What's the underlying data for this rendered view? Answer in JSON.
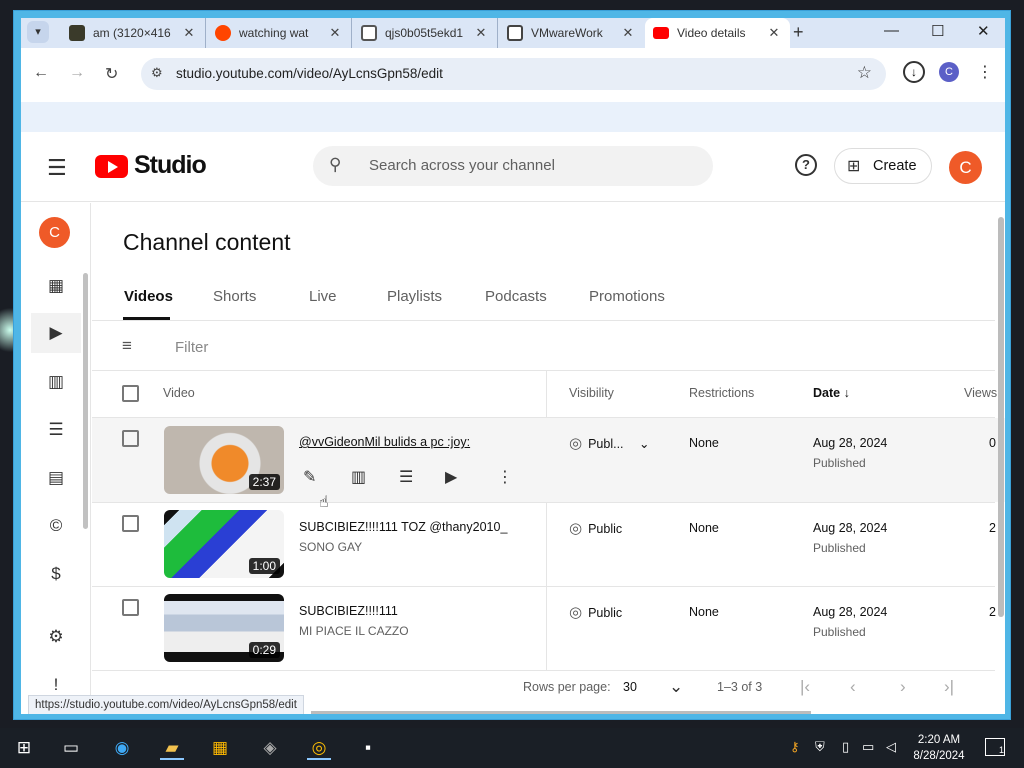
{
  "browser": {
    "tabs": [
      {
        "title": "am (3120×416",
        "favicon_color": "#3a3a2a"
      },
      {
        "title": "watching wat",
        "favicon_color": "#ff4500"
      },
      {
        "title": "qjs0b05t5ekd1",
        "favicon_color": "#555555"
      },
      {
        "title": "VMwareWork",
        "favicon_color": "#444444"
      },
      {
        "title": "Video details",
        "favicon_color": "#ff0000"
      }
    ],
    "new_tab": "+",
    "url": "studio.youtube.com/video/AyLcnsGpn58/edit",
    "profile_initial": "C",
    "status_url": "https://studio.youtube.com/video/AyLcnsGpn58/edit"
  },
  "header": {
    "logo_text": "Studio",
    "search_placeholder": "Search across your channel",
    "help": "?",
    "create_label": "Create",
    "avatar_initial": "C"
  },
  "sidebar": {
    "avatar_initial": "C",
    "items": [
      {
        "name": "dashboard-icon",
        "glyph": "▦"
      },
      {
        "name": "content-icon",
        "glyph": "▶"
      },
      {
        "name": "analytics-icon",
        "glyph": "📊"
      },
      {
        "name": "comments-icon",
        "glyph": "☰"
      },
      {
        "name": "subtitles-icon",
        "glyph": "▤"
      },
      {
        "name": "copyright-icon",
        "glyph": "©"
      },
      {
        "name": "earn-icon",
        "glyph": "$"
      },
      {
        "name": "settings-icon",
        "glyph": "⚙"
      },
      {
        "name": "feedback-icon",
        "glyph": "!"
      }
    ]
  },
  "content": {
    "title": "Channel content",
    "tabs": [
      "Videos",
      "Shorts",
      "Live",
      "Playlists",
      "Podcasts",
      "Promotions"
    ],
    "filter_placeholder": "Filter",
    "columns": {
      "video": "Video",
      "visibility": "Visibility",
      "restrictions": "Restrictions",
      "date": "Date",
      "views": "Views"
    },
    "rows": [
      {
        "title": "@vvGideonMil bulids a pc :joy:",
        "desc": "",
        "duration": "2:37",
        "visibility": "Publ...",
        "restrictions": "None",
        "date": "Aug 28, 2024",
        "date_status": "Published",
        "views": "0"
      },
      {
        "title": "SUBCIBIEZ!!!!111 TOZ @thany2010_",
        "desc": "SONO GAY",
        "duration": "1:00",
        "visibility": "Public",
        "restrictions": "None",
        "date": "Aug 28, 2024",
        "date_status": "Published",
        "views": "2"
      },
      {
        "title": "SUBCIBIEZ!!!!111",
        "desc": "MI PIACE IL CAZZO",
        "duration": "0:29",
        "visibility": "Public",
        "restrictions": "None",
        "date": "Aug 28, 2024",
        "date_status": "Published",
        "views": "2"
      }
    ],
    "pagination": {
      "rows_per_page_label": "Rows per page:",
      "rows_per_page": "30",
      "range": "1–3 of 3"
    }
  },
  "taskbar": {
    "time": "2:20 AM",
    "date": "8/28/2024",
    "notifications": "1"
  },
  "colors": {
    "accent": "#ef5a28",
    "youtube_red": "#ff0000",
    "window_border": "#4fb6e6"
  }
}
